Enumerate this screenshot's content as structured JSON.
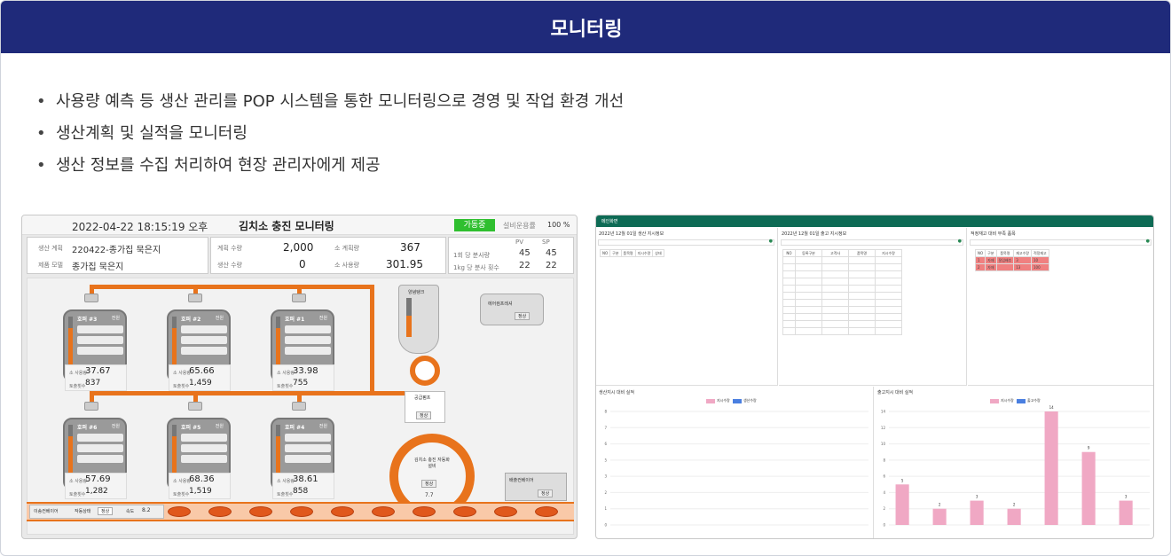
{
  "header": {
    "title": "모니터링"
  },
  "bullets": [
    "사용량 예측 등 생산 관리를 POP 시스템을 통한 모니터링으로 경영 및 작업 환경 개선",
    "생산계획 및 실적을 모니터링",
    "생산 정보를 수집 처리하여 현장 관리자에게 제공"
  ],
  "monitor": {
    "datetime": "2022-04-22  18:15:19 오후",
    "title": "김치소 충진 모니터링",
    "status": "가동중",
    "utilization_label": "설비운용률",
    "utilization": "100 %",
    "plan_label": "생산 계획",
    "plan_value": "220422-종가집 묵은지",
    "product_label": "제품 모델",
    "product_value": "종가집 묵은지",
    "qty_plan_label": "계획 수량",
    "qty_plan": "2,000",
    "qty_prod_label": "생산 수량",
    "qty_prod": "0",
    "plan_use_label": "소 계획량",
    "plan_use": "367",
    "use_label": "소 사용량",
    "use": "301.95",
    "pv_label": "PV",
    "sp_label": "SP",
    "r1_label": "1회 당 분사량",
    "r1_pv": "45",
    "r1_sp": "45",
    "r2_label": "1kg 당 분사 횟수",
    "r2_pv": "22",
    "r2_sp": "22",
    "tanks": [
      {
        "name": "호퍼 #3",
        "val": "37.67",
        "cnt": "837"
      },
      {
        "name": "호퍼 #2",
        "val": "65.66",
        "cnt": "1,459"
      },
      {
        "name": "호퍼 #1",
        "val": "33.98",
        "cnt": "755"
      },
      {
        "name": "호퍼 #6",
        "val": "57.69",
        "cnt": "1,282"
      },
      {
        "name": "호퍼 #5",
        "val": "68.36",
        "cnt": "1,519"
      },
      {
        "name": "호퍼 #4",
        "val": "38.61",
        "cnt": "858"
      }
    ],
    "tank_run": "전원",
    "tank_use_label": "소 사용량",
    "tank_cnt_label": "토출횟수",
    "conveyor_label": "이송컨베이어",
    "conveyor_state_label": "작동상태",
    "conveyor_state": "정상",
    "speed_label": "속도",
    "speed": "8.2",
    "right_top_label": "에어컴프레셔",
    "right_top_state": "정상",
    "supply_label": "공급펌프",
    "supply_state": "정상",
    "fill_title": "김치소 충진 자동화 설비",
    "fill_state": "정상",
    "fill_val": "7.7",
    "tank_small_label": "양념탱크",
    "discharge_label": "배출컨베이어",
    "discharge_state": "정상"
  },
  "orders": {
    "app_title": "메인화면",
    "p1_title": "2022년 12월 01일 생산 지시정보",
    "p2_title": "2022년 12월 01일 출고 지시정보",
    "p3_title": "적정재고 대비 부족 품목",
    "p1_cols": [
      "NO",
      "구분",
      "품목명",
      "지시수량",
      "상태"
    ],
    "p2_cols": [
      "NO",
      "등록구분",
      "고객사",
      "품목명",
      "지시수량"
    ],
    "p3_cols": [
      "NO",
      "구분",
      "품목명",
      "재고수량",
      "적정재고"
    ],
    "p3_rows": [
      [
        "1",
        "자재",
        "절임배추",
        "3",
        "10"
      ],
      [
        "2",
        "자재",
        "",
        "13",
        "100"
      ]
    ],
    "c1_title": "생산지시 대비 실적",
    "c2_title": "출고지시 대비 실적",
    "legend_a": "지시수량",
    "legend_b": "생산수량",
    "legend_c": "출고수량"
  },
  "chart_data": [
    {
      "type": "bar",
      "title": "생산지시 대비 실적",
      "series": [
        {
          "name": "지시수량",
          "values": []
        },
        {
          "name": "생산수량",
          "values": []
        }
      ],
      "ylim": [
        0,
        8
      ]
    },
    {
      "type": "bar",
      "title": "출고지시 대비 실적",
      "categories": [
        "",
        "",
        "",
        "",
        "",
        "",
        ""
      ],
      "series": [
        {
          "name": "지시수량",
          "values": [
            5,
            2,
            3,
            2,
            14,
            9,
            3
          ]
        },
        {
          "name": "출고수량",
          "values": [
            0,
            0,
            0,
            0,
            0,
            0,
            0
          ]
        }
      ],
      "ylim": [
        0,
        14
      ]
    }
  ]
}
